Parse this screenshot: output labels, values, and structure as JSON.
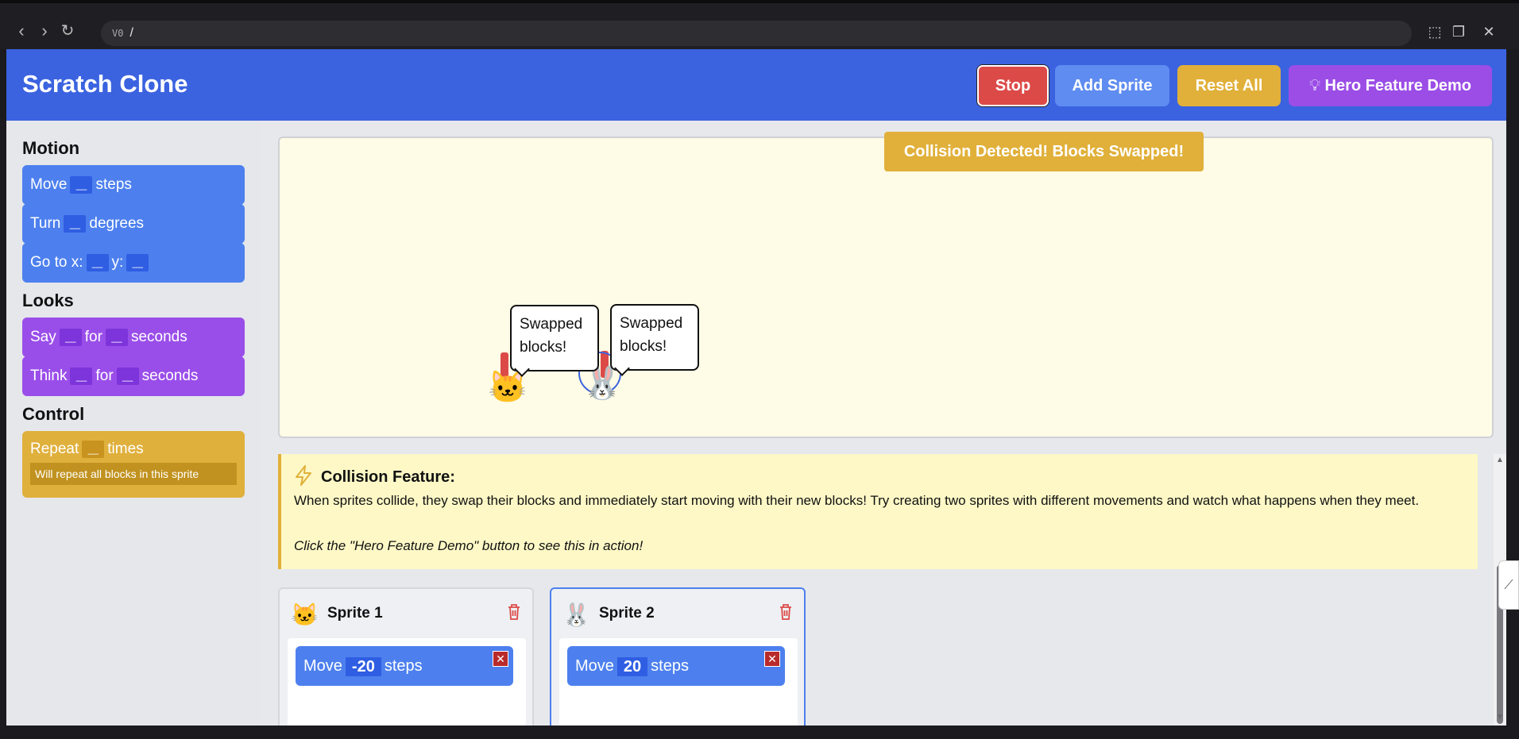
{
  "browser": {
    "url_tag": "V0",
    "url": "/"
  },
  "app": {
    "title": "Scratch Clone",
    "buttons": {
      "stop": "Stop",
      "add_sprite": "Add Sprite",
      "reset_all": "Reset All",
      "hero_demo": "Hero Feature Demo"
    }
  },
  "sidebar": {
    "motion": {
      "heading": "Motion",
      "move": {
        "a": "Move",
        "b": "steps"
      },
      "turn": {
        "a": "Turn",
        "b": "degrees"
      },
      "goto": {
        "a": "Go to x:",
        "b": "y:"
      }
    },
    "looks": {
      "heading": "Looks",
      "say": {
        "a": "Say",
        "b": "for",
        "c": "seconds"
      },
      "think": {
        "a": "Think",
        "b": "for",
        "c": "seconds"
      }
    },
    "control": {
      "heading": "Control",
      "repeat": {
        "a": "Repeat",
        "b": "times",
        "note": "Will repeat all blocks in this sprite"
      }
    },
    "slot_placeholder": "__"
  },
  "stage": {
    "toast": "Collision Detected! Blocks Swapped!",
    "sprite1_emoji": "🐱",
    "sprite2_emoji": "🐰",
    "bubble1": "Swapped blocks!",
    "bubble2": "Swapped blocks!"
  },
  "info": {
    "title": "Collision Feature:",
    "text": "When sprites collide, they swap their blocks and immediately start moving with their new blocks! Try creating two sprites with different movements and watch what happens when they meet.",
    "hint": "Click the \"Hero Feature Demo\" button to see this in action!"
  },
  "sprites": [
    {
      "name": "Sprite 1",
      "emoji": "🐱",
      "block": {
        "a": "Move",
        "value": "-20",
        "b": "steps"
      }
    },
    {
      "name": "Sprite 2",
      "emoji": "🐰",
      "block": {
        "a": "Move",
        "value": "20",
        "b": "steps"
      }
    }
  ],
  "colors": {
    "header": "#3b63e0",
    "motion": "#4d80ee",
    "looks": "#9a4ee9",
    "control": "#e0b03c",
    "stop": "#dc4a48"
  }
}
